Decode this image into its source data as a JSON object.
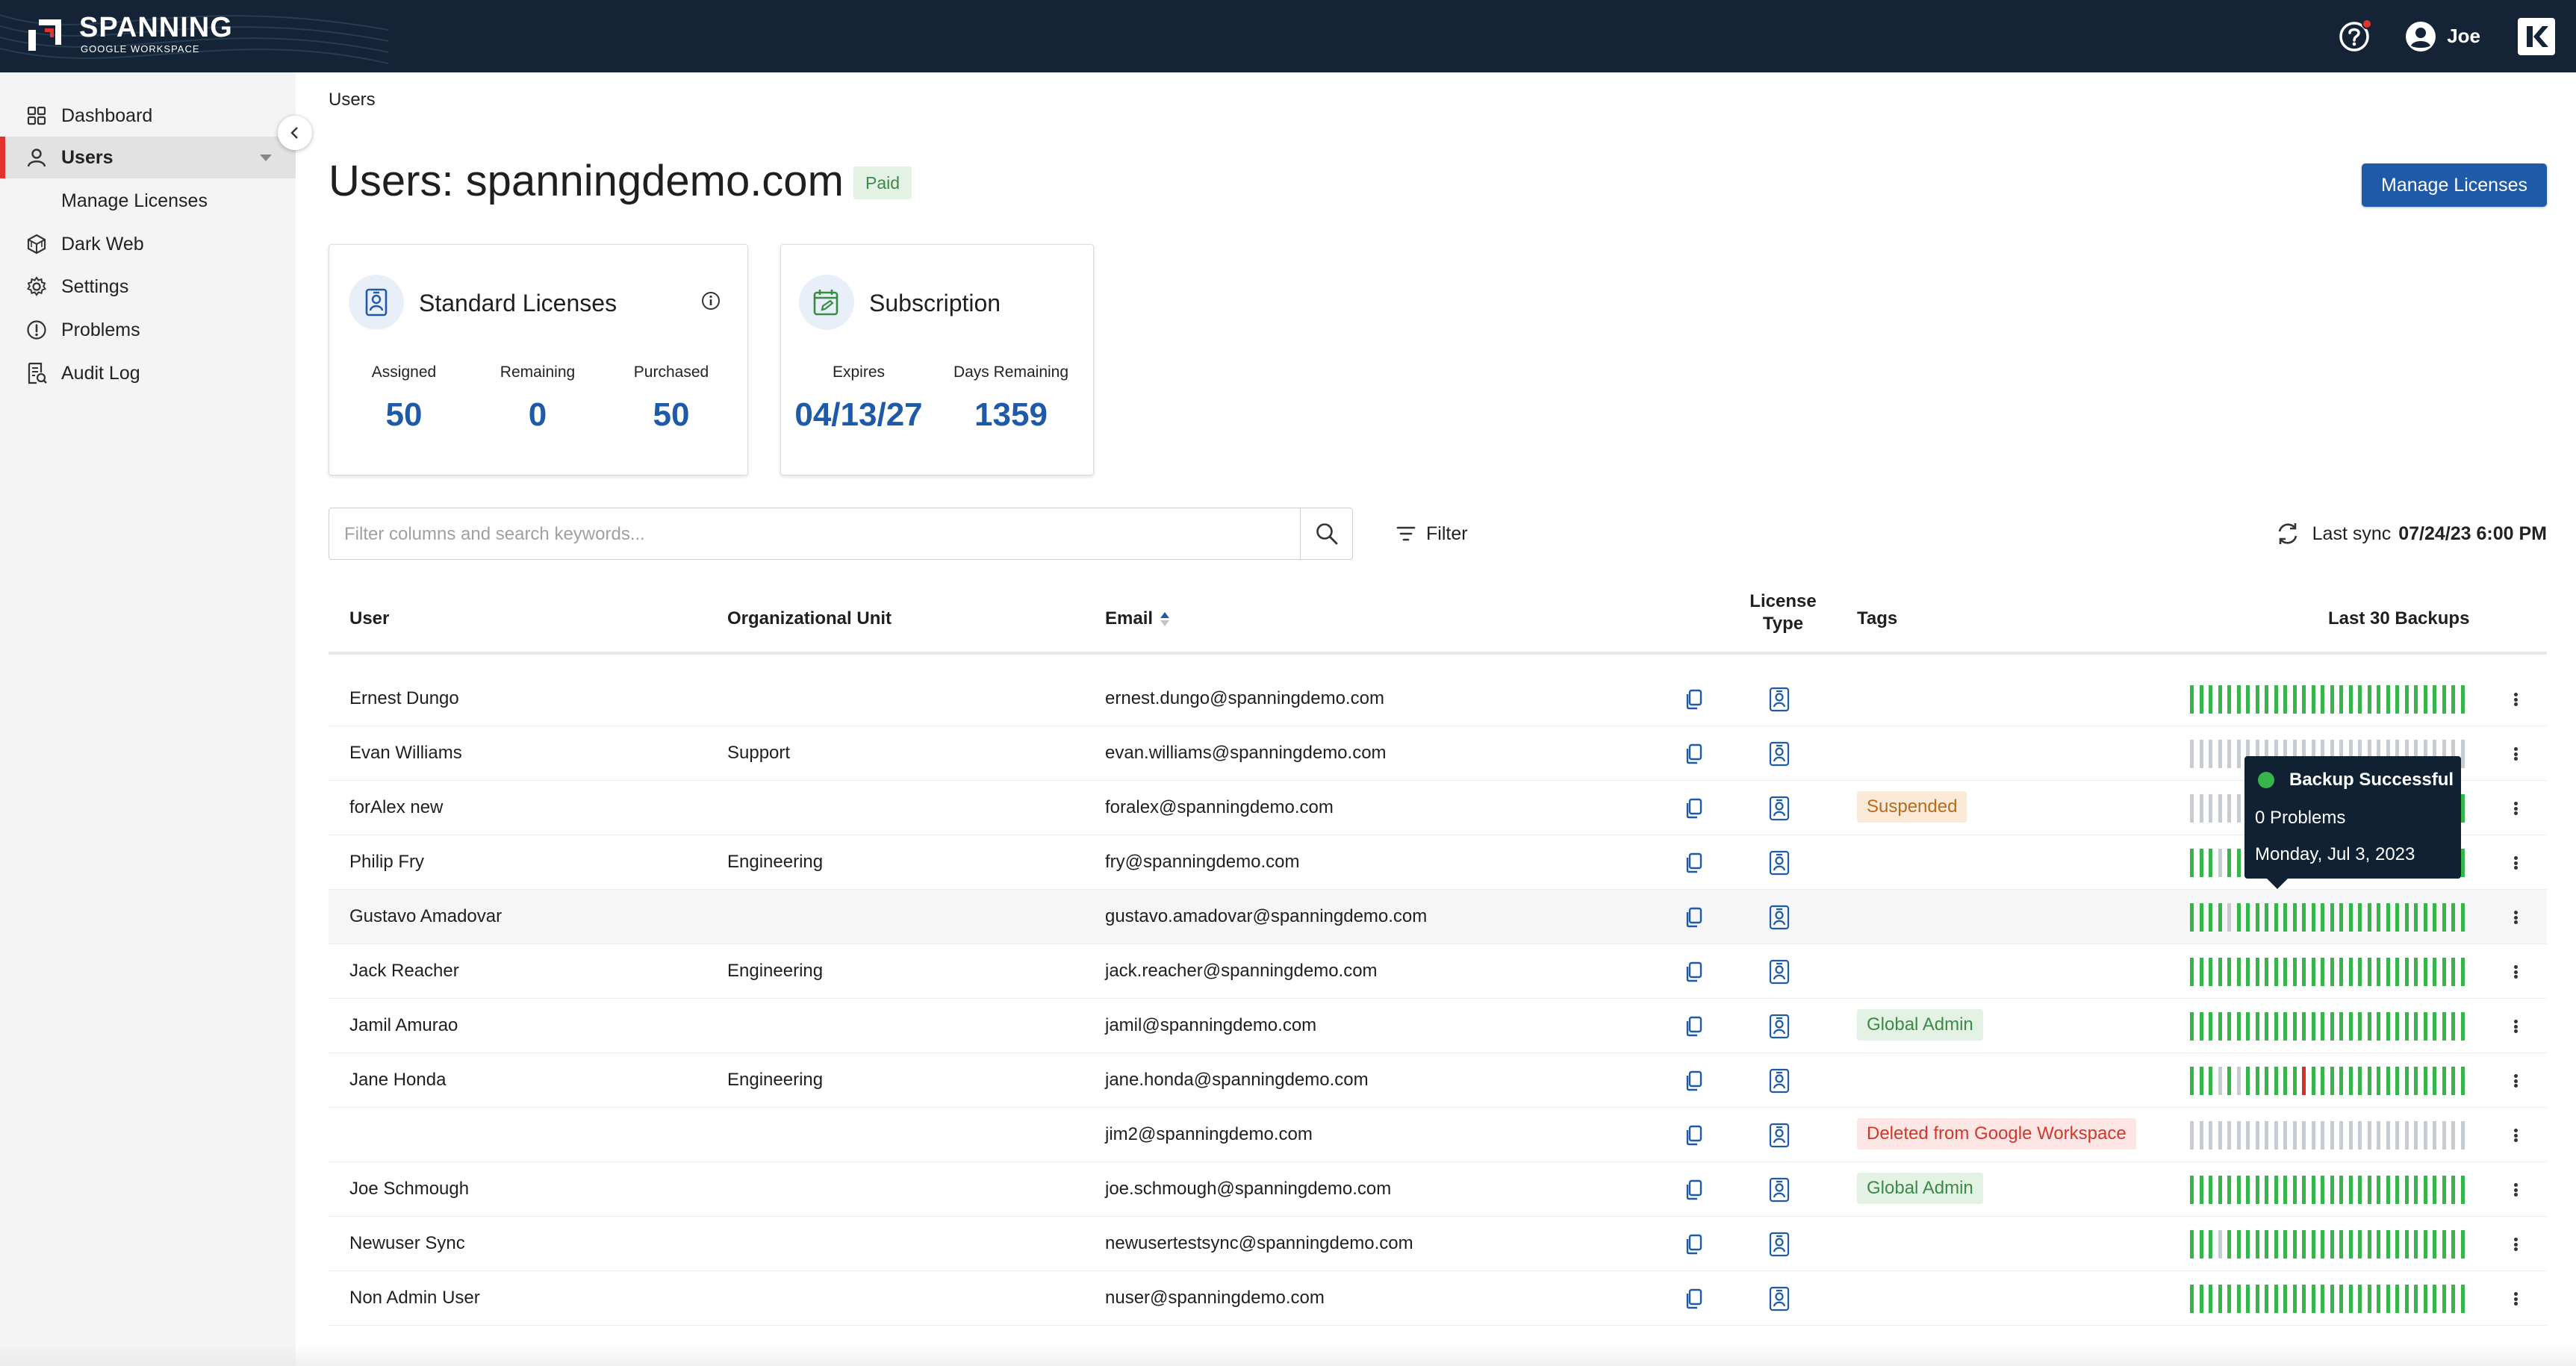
{
  "brand": {
    "title": "SPANNING",
    "subtitle": "GOOGLE WORKSPACE",
    "accent": "#e2342f",
    "header_bg": "#142436",
    "link_color": "#1e5aa8"
  },
  "header": {
    "help_icon": "help-circle-icon",
    "user_name": "Joe",
    "user_icon": "account-circle-icon",
    "app_logo": "kaseya-icon"
  },
  "sidebar": {
    "items": [
      {
        "label": "Dashboard",
        "icon": "dashboard-grid-icon"
      },
      {
        "label": "Users",
        "icon": "user-icon",
        "active": true
      },
      {
        "label": "Manage Licenses",
        "icon": ""
      },
      {
        "label": "Dark Web",
        "icon": "dark-web-icon"
      },
      {
        "label": "Settings",
        "icon": "gear-icon"
      },
      {
        "label": "Problems",
        "icon": "alert-circle-icon"
      },
      {
        "label": "Audit Log",
        "icon": "audit-log-icon"
      }
    ]
  },
  "breadcrumb": "Users",
  "page": {
    "title": "Users: spanningdemo.com",
    "plan_badge": "Paid",
    "manage_button": "Manage Licenses"
  },
  "licenses_card": {
    "title": "Standard Licenses",
    "stats": [
      {
        "label": "Assigned",
        "value": "50"
      },
      {
        "label": "Remaining",
        "value": "0"
      },
      {
        "label": "Purchased",
        "value": "50"
      }
    ]
  },
  "subscription_card": {
    "title": "Subscription",
    "stats": [
      {
        "label": "Expires",
        "value": "04/13/27"
      },
      {
        "label": "Days Remaining",
        "value": "1359"
      }
    ]
  },
  "toolbar": {
    "search_placeholder": "Filter columns and search keywords...",
    "filter_label": "Filter",
    "sync_label": "Last sync",
    "sync_time": "07/24/23 6:00 PM"
  },
  "table": {
    "columns": {
      "user": "User",
      "ou": "Organizational Unit",
      "email": "Email",
      "license_type": "License Type",
      "tags": "Tags",
      "backups": "Last 30 Backups"
    },
    "rows": [
      {
        "user": "Ernest Dungo",
        "ou": "",
        "email": "ernest.dungo@spanningdemo.com",
        "tag": "",
        "backups": "GGGGGGGGGGGGGGGGGGGGGGGGGGGGGG"
      },
      {
        "user": "Evan Williams",
        "ou": "Support",
        "email": "evan.williams@spanningdemo.com",
        "tag": "",
        "backups": "NNNNNNNNNNNNNNNNNNNNNNNNNNNNNN"
      },
      {
        "user": "forAlex new",
        "ou": "",
        "email": "foralex@spanningdemo.com",
        "tag": "Suspended",
        "tag_type": "suspended",
        "backups": "NNNNNNNNNNNNNNNNNNNNNNNNNNNNNG"
      },
      {
        "user": "Philip Fry",
        "ou": "Engineering",
        "email": "fry@spanningdemo.com",
        "tag": "",
        "backups": "GGGNGGGGGGGGGGGGGGGGGGGGGGGGGG"
      },
      {
        "user": "Gustavo Amadovar",
        "ou": "",
        "email": "gustavo.amadovar@spanningdemo.com",
        "tag": "",
        "backups": "GGGGNGGGGGGGGGGGGGGGGGGGGGGGGG"
      },
      {
        "user": "Jack Reacher",
        "ou": "Engineering",
        "email": "jack.reacher@spanningdemo.com",
        "tag": "",
        "backups": "GGGGGGGGGGGGGGGGGGGGGGGGGGGGGG"
      },
      {
        "user": "Jamil Amurao",
        "ou": "",
        "email": "jamil@spanningdemo.com",
        "tag": "Global Admin",
        "tag_type": "admin",
        "backups": "GGGGGGGGGGGGGGGGGGGGGGGGGGGGGG"
      },
      {
        "user": "Jane Honda",
        "ou": "Engineering",
        "email": "jane.honda@spanningdemo.com",
        "tag": "",
        "backups": "GGGNGNGGGGGGRGGGGGGGGGGGGGGGGG"
      },
      {
        "user": "",
        "ou": "",
        "email": "jim2@spanningdemo.com",
        "tag": "Deleted from Google Workspace",
        "tag_type": "deleted",
        "backups": "NNNNNNNNNNNNNNNNNNNNNNNNNNNNNN"
      },
      {
        "user": "Joe Schmough",
        "ou": "",
        "email": "joe.schmough@spanningdemo.com",
        "tag": "Global Admin",
        "tag_type": "admin",
        "backups": "GGGGGGGGGGGGGGGGGGGGGGGGGGGGGG"
      },
      {
        "user": "Newuser Sync",
        "ou": "",
        "email": "newusertestsync@spanningdemo.com",
        "tag": "",
        "backups": "GGGNGGGGGGGGGGGGGGGGGGGGGGGGGG"
      },
      {
        "user": "Non Admin User",
        "ou": "",
        "email": "nuser@spanningdemo.com",
        "tag": "",
        "backups": "GGGGGGGGGGGGGGGGGGGGGGGGGGGGGG"
      }
    ],
    "backup_colors": {
      "G": "#36b54a",
      "N": "#c7ccd3",
      "R": "#d93025"
    }
  },
  "tooltip": {
    "status": "Backup Successful",
    "problems": "0 Problems",
    "date": "Monday, Jul 3, 2023"
  }
}
